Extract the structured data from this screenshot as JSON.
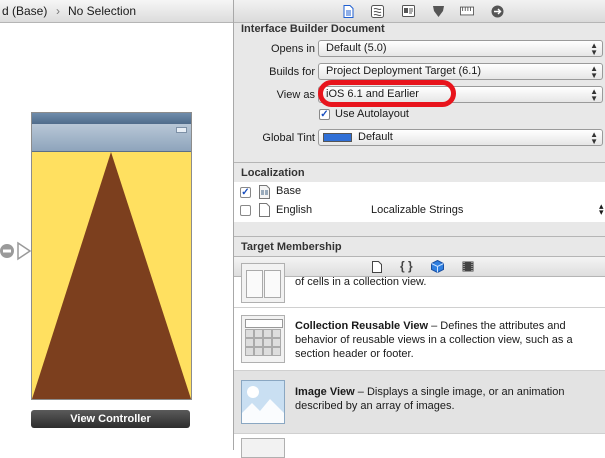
{
  "jumpbar": {
    "crumb1": "d (Base)",
    "crumb2": "No Selection"
  },
  "canvas": {
    "view_controller_label": "View Controller"
  },
  "inspector": {
    "ib_document": {
      "header": "Interface Builder Document",
      "opens_in_label": "Opens in",
      "opens_in_value": "Default (5.0)",
      "builds_for_label": "Builds for",
      "builds_for_value": "Project Deployment Target (6.1)",
      "view_as_label": "View as",
      "view_as_value": "iOS 6.1 and Earlier",
      "use_autolayout_label": "Use Autolayout",
      "global_tint_label": "Global Tint",
      "global_tint_value": "Default",
      "global_tint_color": "#2f6fd6"
    },
    "localization": {
      "header": "Localization",
      "rows": [
        {
          "name": "Base",
          "checked": true,
          "type": ""
        },
        {
          "name": "English",
          "checked": false,
          "type": "Localizable Strings"
        }
      ]
    },
    "target_membership": {
      "header": "Target Membership"
    }
  },
  "library": {
    "items": [
      {
        "title": "",
        "desc": "of cells in a collection view."
      },
      {
        "title": "Collection Reusable View",
        "desc": " – Defines the attributes and behavior of reusable views in a collection view, such as a section header or footer."
      },
      {
        "title": "Image View",
        "desc": " – Displays a single image, or an animation described by an array of images."
      }
    ]
  },
  "colors": {
    "accent_oval": "#e8141c",
    "triangle": "#7c3f1e",
    "view_bg": "#ffe060"
  }
}
